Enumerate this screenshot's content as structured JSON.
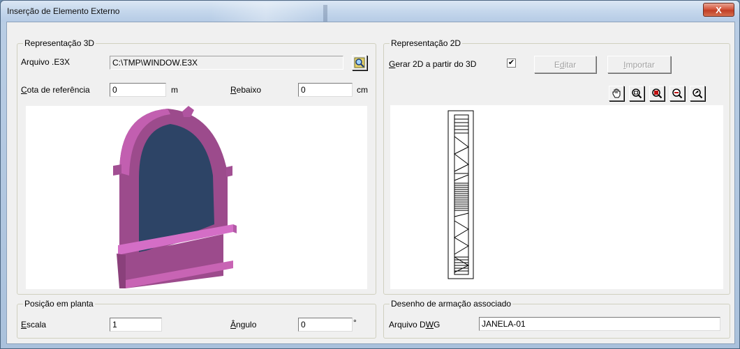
{
  "window": {
    "title": "Inserção de Elemento Externo",
    "close_label": "X"
  },
  "group3d": {
    "legend": "Representação 3D",
    "file_label": "Arquivo .E3X",
    "file_value": "C:\\TMP\\WINDOW.E3X",
    "browse_icon": "magnifier-browse-icon",
    "cota_label_ul": "C",
    "cota_label_rest": "ota de referência",
    "cota_value": "0",
    "cota_unit": "m",
    "rebaixo_label_ul": "R",
    "rebaixo_label_rest": "ebaixo",
    "rebaixo_value": "0",
    "rebaixo_unit": "cm",
    "colors": {
      "frame": "#9c4b8c",
      "frame_light": "#c864b4",
      "glass": "#2d4466",
      "sill": "#d46ec6"
    }
  },
  "group2d": {
    "legend": "Representação 2D",
    "gerar_label_ul": "G",
    "gerar_label_rest": "erar 2D a partir do 3D",
    "gerar_checked": "✔",
    "edit_label_pre": "E",
    "edit_label_ul": "d",
    "edit_label_rest": "itar",
    "import_label_ul": "I",
    "import_label_rest": "mportar",
    "tools": [
      "pan-hand-icon",
      "zoom-window-icon",
      "zoom-extents-icon",
      "zoom-out-icon",
      "zoom-previous-icon"
    ]
  },
  "position": {
    "legend": "Posição em planta",
    "scale_label_ul": "E",
    "scale_label_rest": "scala",
    "scale_value": "1",
    "angle_label_ul": "Â",
    "angle_label_rest": "ngulo",
    "angle_value": "0",
    "angle_unit": "°"
  },
  "drawing": {
    "legend": "Desenho de armação associado",
    "file_label_pre": "Arquivo D",
    "file_label_ul": "W",
    "file_label_rest": "G",
    "file_value": "JANELA-01"
  }
}
